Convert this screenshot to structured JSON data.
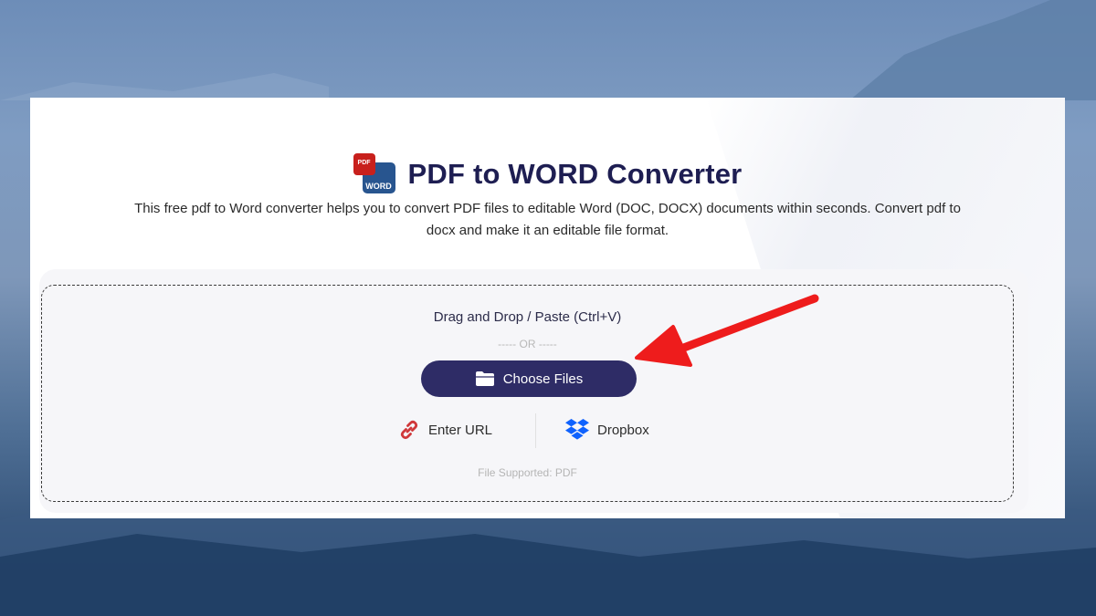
{
  "header": {
    "logo_pdf_text": "PDF",
    "logo_word_text": "WORD",
    "title": "PDF to WORD Converter",
    "description": "This free pdf to Word converter helps you to convert PDF files to editable Word (DOC, DOCX) documents within seconds. Convert pdf to docx and make it an editable file format."
  },
  "upload": {
    "drag_text": "Drag and Drop / Paste (Ctrl+V)",
    "or_text": "----- OR -----",
    "choose_label": "Choose Files",
    "enter_url_label": "Enter URL",
    "dropbox_label": "Dropbox",
    "supported_text": "File Supported: PDF"
  },
  "icons": {
    "folder": "folder-icon",
    "link": "link-icon",
    "dropbox": "dropbox-icon",
    "annotation": "red-arrow"
  },
  "colors": {
    "title": "#1e1e52",
    "button": "#2e2c66",
    "pdf_red": "#c8201c",
    "word_blue": "#28558f",
    "link_red": "#d0383a",
    "dropbox_blue": "#0f62fe",
    "arrow": "#ee1c1c"
  }
}
